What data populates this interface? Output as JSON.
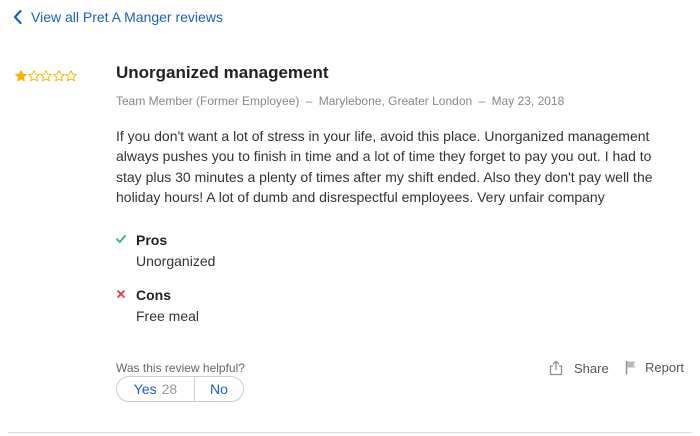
{
  "nav": {
    "back_label": "View all Pret A Manger reviews"
  },
  "review": {
    "rating": 1,
    "rating_max": 5,
    "title": "Unorganized management",
    "author_role": "Team Member (Former Employee)",
    "location": "Marylebone, Greater London",
    "date": "May 23, 2018",
    "separator": "–",
    "body": "If you don't want a lot of stress in your life, avoid this place. Unorganized management always pushes you to finish in time and a lot of time they forget to pay you out. I had to stay plus 30 minutes a plenty of times after my shift ended. Also they don't pay well the holiday hours! A lot of dumb and disrespectful employees. Very unfair company",
    "pros_heading": "Pros",
    "pros_text": "Unorganized",
    "cons_heading": "Cons",
    "cons_text": "Free meal"
  },
  "feedback": {
    "question": "Was this review helpful?",
    "yes_label": "Yes",
    "yes_count": "28",
    "no_label": "No"
  },
  "actions": {
    "share_label": "Share",
    "report_label": "Report"
  },
  "colors": {
    "link": "#1861bf",
    "star_filled": "#f4b400",
    "star_empty": "#f4b400",
    "pros_check": "#2db36f",
    "cons_x": "#d9363e"
  },
  "icons": {
    "back": "chevron-left-icon",
    "star": "star-icon",
    "pros": "check-icon",
    "cons": "x-icon",
    "share": "share-icon",
    "report": "flag-icon"
  }
}
